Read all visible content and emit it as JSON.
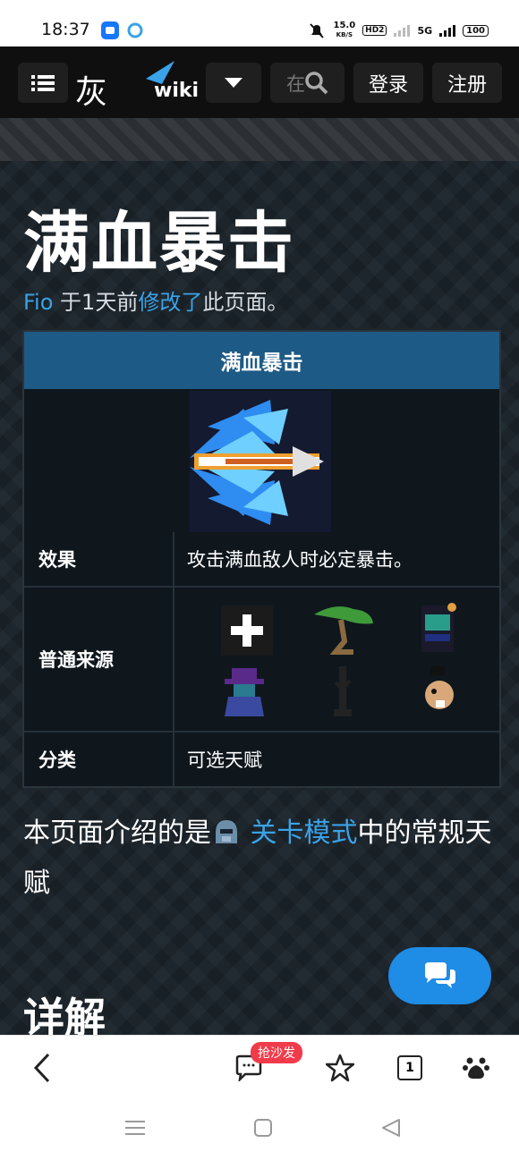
{
  "status_bar": {
    "time": "18:37",
    "speed_value": "15.0",
    "speed_unit": "KB/S",
    "hd": "HD2",
    "network": "5G",
    "battery": "100"
  },
  "nav": {
    "menu_icon": "menu-icon",
    "logo_main": "灰机",
    "logo_wiki": "wiki",
    "dropdown_icon": "caret-down-icon",
    "search_placeholder": "在",
    "login_label": "登录",
    "register_label": "注册"
  },
  "page": {
    "title": "满血暴击",
    "editor": "Fio",
    "edit_prefix": " 于1天前",
    "edit_link": "修改了",
    "edit_suffix": "此页面。",
    "infobox": {
      "header": "满血暴击",
      "effect_label": "效果",
      "effect_value": "攻击满血敌人时必定暴击。",
      "source_label": "普通来源",
      "category_label": "分类",
      "category_value": "可选天赋"
    },
    "intro_prefix": "本页面介绍的是",
    "intro_link": "关卡模式",
    "intro_suffix": "中的常规天赋",
    "section_title": "详解"
  },
  "bottom_bar": {
    "badge": "抢沙发",
    "tabs_count": "1"
  },
  "colors": {
    "accent_link": "#3aa3e8",
    "infobox_header": "#1e5a86",
    "fab": "#1f8ce6",
    "badge": "#f23b4a"
  }
}
